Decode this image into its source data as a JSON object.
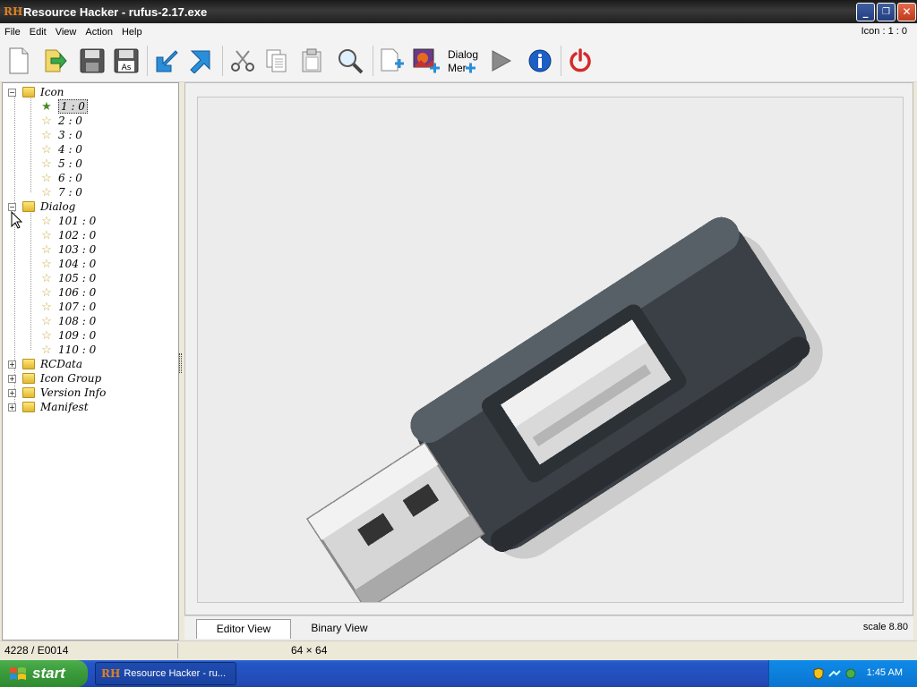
{
  "window": {
    "logo": "RH",
    "title": "Resource Hacker - rufus-2.17.exe",
    "minimize": "_",
    "restore": "❐",
    "close": "✕"
  },
  "menu": {
    "items": [
      {
        "label": "File"
      },
      {
        "label": "Edit"
      },
      {
        "label": "View"
      },
      {
        "label": "Action"
      },
      {
        "label": "Help"
      }
    ],
    "status_right": "Icon : 1 : 0"
  },
  "toolbar": {
    "buttons": [
      {
        "name": "new-icon"
      },
      {
        "name": "open-icon"
      },
      {
        "name": "save-icon"
      },
      {
        "name": "save-as-icon",
        "text": "As"
      },
      {
        "name": "import-icon"
      },
      {
        "name": "export-icon"
      },
      {
        "name": "cut-icon"
      },
      {
        "name": "copy-icon"
      },
      {
        "name": "paste-icon"
      },
      {
        "name": "search-icon"
      },
      {
        "name": "add-resource-icon"
      },
      {
        "name": "add-image-icon"
      },
      {
        "name": "dialog-menu-icon",
        "text_line1": "Dialog",
        "text_line2": "Mer"
      },
      {
        "name": "run-icon"
      },
      {
        "name": "info-icon"
      },
      {
        "name": "power-icon"
      }
    ]
  },
  "tree": {
    "groups": [
      {
        "label": "Icon",
        "expanded": true,
        "expander": "−",
        "items": [
          "1 : 0",
          "2 : 0",
          "3 : 0",
          "4 : 0",
          "5 : 0",
          "6 : 0",
          "7 : 0"
        ],
        "selected": "1 : 0"
      },
      {
        "label": "Dialog",
        "expanded": true,
        "expander": "−",
        "items": [
          "101 : 0",
          "102 : 0",
          "103 : 0",
          "104 : 0",
          "105 : 0",
          "106 : 0",
          "107 : 0",
          "108 : 0",
          "109 : 0",
          "110 : 0"
        ]
      },
      {
        "label": "RCData",
        "expanded": false,
        "expander": "+"
      },
      {
        "label": "Icon Group",
        "expanded": false,
        "expander": "+"
      },
      {
        "label": "Version Info",
        "expanded": false,
        "expander": "+"
      },
      {
        "label": "Manifest",
        "expanded": false,
        "expander": "+"
      }
    ]
  },
  "editor": {
    "preview_subject": "usb-flash-drive-icon",
    "tabs": [
      {
        "label": "Editor View",
        "active": true
      },
      {
        "label": "Binary View",
        "active": false
      }
    ],
    "scale": "scale 8.80"
  },
  "statusbar": {
    "left": "4228 / E0014",
    "middle": "64 × 64"
  },
  "taskbar": {
    "start": "start",
    "task_logo": "RH",
    "task_label": "Resource Hacker - ru...",
    "clock": "1:45 AM"
  },
  "colors": {
    "titlebar": "#2a2a2a",
    "taskbar": "#2457c8",
    "start": "#3a9a3a",
    "tray": "#0f8be8"
  }
}
